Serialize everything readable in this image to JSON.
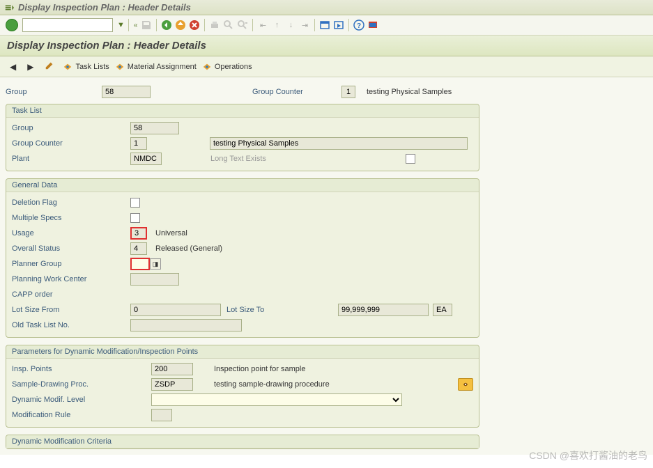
{
  "titlebar": {
    "text": "Display Inspection Plan : Header Details"
  },
  "page_header": {
    "text": "Display Inspection Plan : Header Details"
  },
  "nav": {
    "task_lists": "Task Lists",
    "material_assignment": "Material Assignment",
    "operations": "Operations"
  },
  "top": {
    "group_label": "Group",
    "group_value": "58",
    "counter_label": "Group Counter",
    "counter_value": "1",
    "desc": "testing Physical Samples"
  },
  "task_list": {
    "title": "Task List",
    "group_label": "Group",
    "group_value": "58",
    "counter_label": "Group Counter",
    "counter_value": "1",
    "counter_desc": "testing Physical Samples",
    "plant_label": "Plant",
    "plant_value": "NMDC",
    "long_text_label": "Long Text Exists"
  },
  "general": {
    "title": "General Data",
    "deletion_flag": "Deletion Flag",
    "multiple_specs": "Multiple Specs",
    "usage_label": "Usage",
    "usage_value": "3",
    "usage_desc": "Universal",
    "status_label": "Overall Status",
    "status_value": "4",
    "status_desc": "Released (General)",
    "planner_group_label": "Planner Group",
    "planner_group_value": "",
    "pwc_label": "Planning Work Center",
    "pwc_value": "",
    "capp_label": "CAPP order",
    "lot_from_label": "Lot Size From",
    "lot_from_value": "0",
    "lot_to_label": "Lot Size To",
    "lot_to_value": "99,999,999",
    "lot_unit": "EA",
    "old_task_label": "Old Task List No.",
    "old_task_value": ""
  },
  "params": {
    "title": "Parameters for Dynamic Modification/Inspection Points",
    "insp_points_label": "Insp. Points",
    "insp_points_value": "200",
    "insp_points_desc": "Inspection point for sample",
    "sdp_label": "Sample-Drawing Proc.",
    "sdp_value": "ZSDP",
    "sdp_desc": "testing sample-drawing procedure",
    "dml_label": "Dynamic Modif. Level",
    "mr_label": "Modification Rule"
  },
  "dmc": {
    "title": "Dynamic Modification Criteria"
  },
  "watermark": "CSDN @喜欢打酱油的老鸟"
}
